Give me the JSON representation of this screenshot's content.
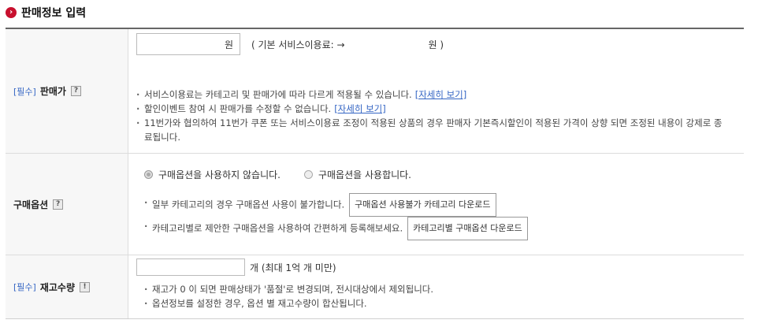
{
  "section": {
    "title": "판매정보 입력",
    "icon": "chevron-right-icon"
  },
  "price": {
    "required": "[필수]",
    "label": "판매가",
    "help": "?",
    "unit": "원",
    "fee_prefix": "( 기본 서비스이용료: →",
    "fee_unit": "원 )",
    "notes": [
      "서비스이용료는 카테고리 및 판매가에 따라 다르게 적용될 수 있습니다.",
      "할인이벤트 참여 시 판매가를 수정할 수 없습니다.",
      "11번가와 협의하여 11번가 쿠폰 또는 서비스이용료 조정이 적용된 상품의 경우 판매자 기본즉시할인이 적용된 가격이 상향 되면 조정된 내용이 강제로 종료됩니다."
    ],
    "link_label": "[자세히 보기]"
  },
  "options": {
    "label": "구매옵션",
    "help": "?",
    "radio_no": "구매옵션을 사용하지 않습니다.",
    "radio_yes": "구매옵션을 사용합니다.",
    "note1": "일부 카테고리의 경우 구매옵션 사용이 불가합니다.",
    "btn1": "구매옵션 사용불가 카테고리 다운로드",
    "note2": "카테고리별로 제안한 구매옵션을 사용하여 간편하게 등록해보세요.",
    "btn2": "카테고리별 구매옵션 다운로드"
  },
  "stock": {
    "required": "[필수]",
    "label": "재고수량",
    "help": "!",
    "unit_note": "개  (최대 1억 개 미만)",
    "notes": [
      "재고가 0 이 되면 판매상태가 '품절'로 변경되며, 전시대상에서 제외됩니다.",
      "옵션정보를 설정한 경우, 옵션 별 재고수량이 합산됩니다."
    ]
  }
}
